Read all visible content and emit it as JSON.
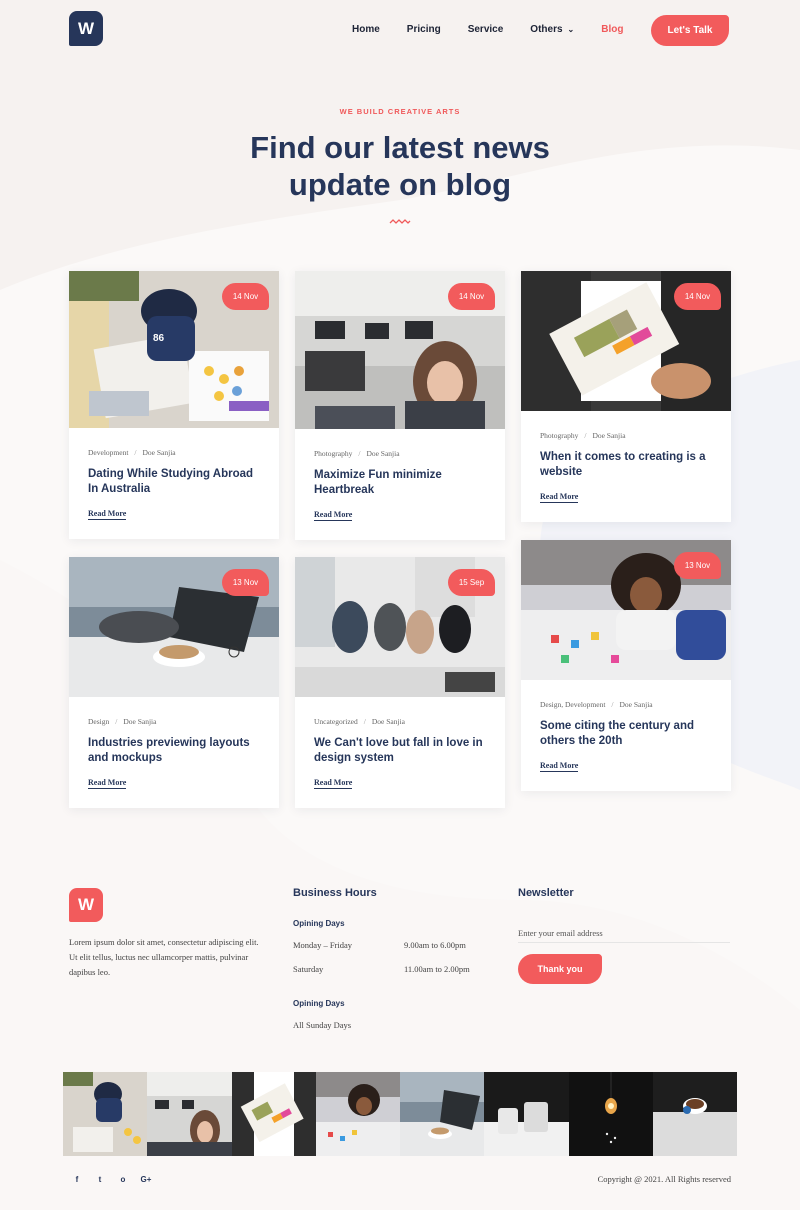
{
  "brand": {
    "logo_letter": "W",
    "primary": "#26365a",
    "accent": "#f25b5c"
  },
  "nav": {
    "items": [
      {
        "label": "Home",
        "active": false
      },
      {
        "label": "Pricing",
        "active": false
      },
      {
        "label": "Service",
        "active": false
      },
      {
        "label": "Others",
        "active": false,
        "has_dropdown": true
      },
      {
        "label": "Blog",
        "active": true
      }
    ],
    "cta": "Let's Talk"
  },
  "hero": {
    "eyebrow": "WE BUILD CREATIVE ARTS",
    "title_line1": "Find our latest news",
    "title_line2": "update on blog"
  },
  "posts": [
    {
      "date": "14 Nov",
      "category": "Development",
      "author": "Doe Sanjia",
      "title": "Dating While Studying Abroad In Australia",
      "read_more": "Read More",
      "image": "kid-drawing"
    },
    {
      "date": "14 Nov",
      "category": "Photography",
      "author": "Doe Sanjia",
      "title": "Maximize Fun minimize Heartbreak",
      "read_more": "Read More",
      "image": "office-students"
    },
    {
      "date": "14 Nov",
      "category": "Photography",
      "author": "Doe Sanjia",
      "title": "When it comes to creating is a website",
      "read_more": "Read More",
      "image": "color-swatches"
    },
    {
      "date": "13 Nov",
      "category": "Design",
      "author": "Doe Sanjia",
      "title": "Industries previewing layouts and mockups",
      "read_more": "Read More",
      "image": "coffee-laptop"
    },
    {
      "date": "15 Sep",
      "category": "Uncategorized",
      "author": "Doe Sanjia",
      "title": "We Can't love but fall in love in design system",
      "read_more": "Read More",
      "image": "team-meeting"
    },
    {
      "date": "13 Nov",
      "category": "Design, Development",
      "author": "Doe Sanjia",
      "title": "Some citing the century and others the 20th",
      "read_more": "Read More",
      "image": "girl-crafts"
    }
  ],
  "footer": {
    "logo_letter": "W",
    "about": "Lorem ipsum dolor sit amet, consectetur adipiscing elit. Ut elit tellus, luctus nec ullamcorper mattis, pulvinar dapibus leo.",
    "hours": {
      "heading": "Business Hours",
      "open_label": "Opining Days",
      "rows": [
        {
          "day": "Monday – Friday",
          "time": "9.00am to 6.00pm"
        },
        {
          "day": "Saturday",
          "time": "11.00am to 2.00pm"
        }
      ],
      "closed_label": "Opining Days",
      "closed_text": "All Sunday Days"
    },
    "newsletter": {
      "heading": "Newsletter",
      "placeholder": "Enter your email address",
      "button": "Thank you"
    },
    "gallery": [
      "kid-drawing",
      "office-students",
      "color-swatches",
      "girl-crafts",
      "coffee-laptop",
      "cups-dark",
      "lamp-dark",
      "coffee-hand"
    ],
    "socials": [
      "f",
      "t",
      "o",
      "G+"
    ],
    "social_icons": [
      "facebook-icon",
      "twitter-icon",
      "instagram-icon",
      "google-plus-icon"
    ],
    "copyright": "Copyright @ 2021. All Rights reserved"
  }
}
